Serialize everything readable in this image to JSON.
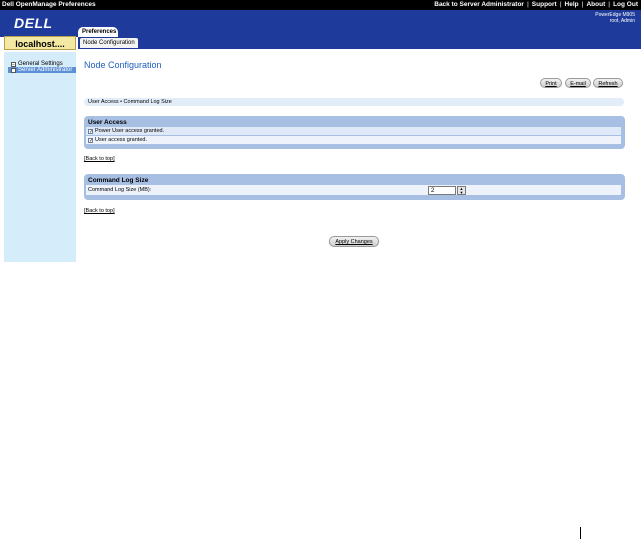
{
  "topbar": {
    "title": "Dell OpenManage Preferences",
    "links": [
      "Back to Server Administrator",
      "Support",
      "Help",
      "About",
      "Log Out"
    ]
  },
  "header": {
    "logo": "DELL",
    "server_model": "PowerEdge M905",
    "user": "root, Admin",
    "tab": "Preferences"
  },
  "host": "localhost....",
  "subtab": "Node Configuration",
  "sidebar": {
    "items": [
      {
        "label": "General Settings",
        "expander": "−"
      },
      {
        "label": "Server Administrator",
        "expander": "−"
      }
    ]
  },
  "main": {
    "title": "Node Configuration",
    "buttons": {
      "print": "Print",
      "email": "E-mail",
      "refresh": "Refresh"
    },
    "breadcrumb": "User Access  •  Command Log Size",
    "user_access": {
      "header": "User Access",
      "options": [
        {
          "label": "Power User access granted.",
          "checked": true
        },
        {
          "label": "User access granted.",
          "checked": true
        }
      ]
    },
    "back_to_top": "Back to top",
    "command_log": {
      "header": "Command Log Size",
      "label": "Command Log Size (MB):",
      "value": "2"
    },
    "apply": "Apply Changes"
  },
  "colors": {
    "header_blue": "#1e3a9a",
    "section_blue": "#a7bfe3",
    "sidebar_bg": "#d5ecfa",
    "title_blue": "#1e5fbf"
  }
}
